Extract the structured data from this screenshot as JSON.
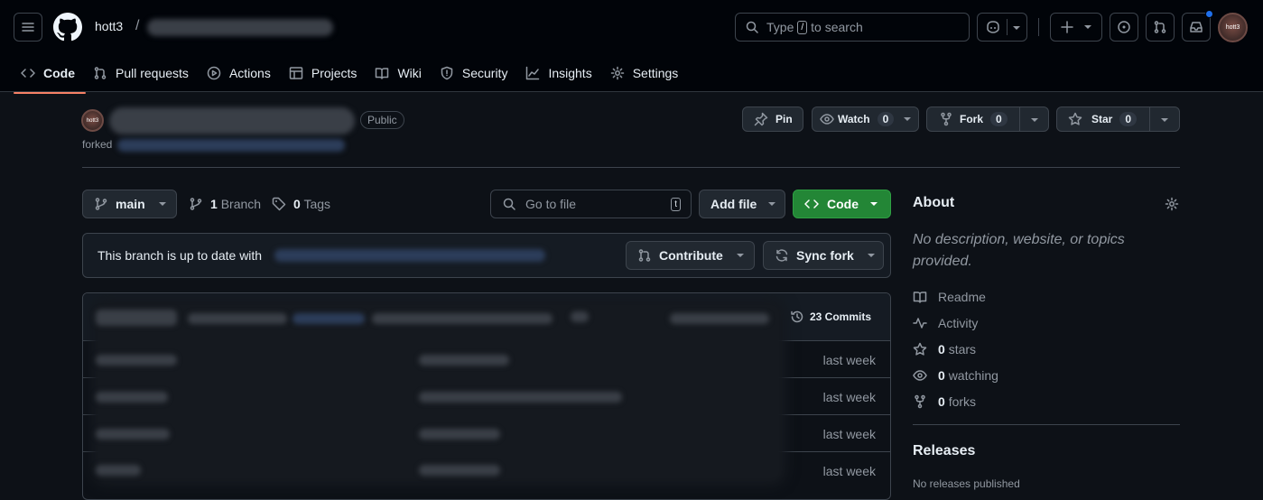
{
  "header": {
    "owner": "hott3",
    "separator": "/",
    "search_prefix": "Type",
    "search_key": "/",
    "search_suffix": "to search",
    "avatar_text": "hott3"
  },
  "tabs": [
    {
      "label": "Code",
      "icon": "code-icon",
      "active": true
    },
    {
      "label": "Pull requests",
      "icon": "pull-request-icon"
    },
    {
      "label": "Actions",
      "icon": "play-icon"
    },
    {
      "label": "Projects",
      "icon": "table-icon"
    },
    {
      "label": "Wiki",
      "icon": "book-icon"
    },
    {
      "label": "Security",
      "icon": "shield-icon"
    },
    {
      "label": "Insights",
      "icon": "graph-icon"
    },
    {
      "label": "Settings",
      "icon": "gear-icon"
    }
  ],
  "repo": {
    "avatar_text": "hott3",
    "visibility": "Public",
    "forked_label": "forked",
    "pin_label": "Pin",
    "watch_label": "Watch",
    "watch_count": "0",
    "fork_label": "Fork",
    "fork_count": "0",
    "star_label": "Star",
    "star_count": "0"
  },
  "toolbar": {
    "branch": "main",
    "branch_count": "1",
    "branch_word": "Branch",
    "tag_count": "0",
    "tag_word": "Tags",
    "goto_placeholder": "Go to file",
    "goto_key": "t",
    "add_file": "Add file",
    "code": "Code"
  },
  "sync": {
    "status_text": "This branch is up to date with",
    "contribute": "Contribute",
    "sync_fork": "Sync fork"
  },
  "files": {
    "commits": "23 Commits",
    "rows": [
      {
        "time": "last week"
      },
      {
        "time": "last week"
      },
      {
        "time": "last week"
      },
      {
        "time": "last week"
      }
    ]
  },
  "about": {
    "title": "About",
    "description": "No description, website, or topics provided.",
    "readme": "Readme",
    "activity": "Activity",
    "stars_count": "0",
    "stars_word": "stars",
    "watching_count": "0",
    "watching_word": "watching",
    "forks_count": "0",
    "forks_word": "forks"
  },
  "releases": {
    "title": "Releases",
    "empty": "No releases published"
  },
  "colors": {
    "background": "#0d1117",
    "header": "#010409",
    "accent_tab": "#f78166",
    "green": "#238636",
    "notification": "#1f6feb"
  }
}
